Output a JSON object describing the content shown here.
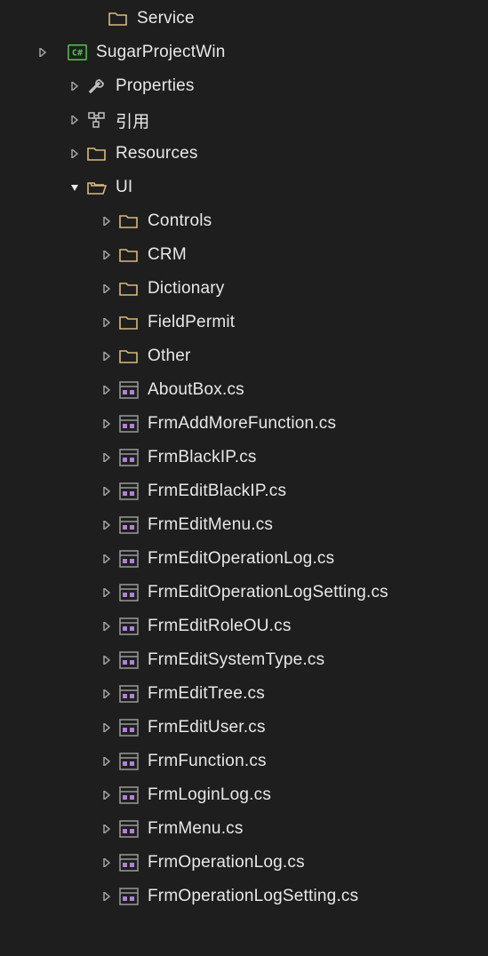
{
  "colors": {
    "background": "#1e1e1e",
    "text": "#e8e8e8",
    "arrow": "#a0a0a0",
    "folderOutline": "#d7ba7d",
    "folderOpen": "#d7ba7d",
    "csharpGreen": "#4ec94e",
    "csharpText": "#4ec94e",
    "wrench": "#c0c0c0",
    "refIcon": "#c0c0c0",
    "formPurple": "#b180d7",
    "formBorder": "#888888"
  },
  "rows": [
    {
      "level": "lvl0b",
      "arrow": "none",
      "icon": "folder",
      "label": "Service"
    },
    {
      "level": "lvl0",
      "arrow": "right",
      "icon": "csharp",
      "label": "SugarProjectWin",
      "noIndentArrow": true
    },
    {
      "level": "lvl1",
      "arrow": "right",
      "icon": "wrench",
      "label": "Properties"
    },
    {
      "level": "lvl1",
      "arrow": "right",
      "icon": "reference",
      "label": "引用"
    },
    {
      "level": "lvl1",
      "arrow": "right",
      "icon": "folder",
      "label": "Resources"
    },
    {
      "level": "lvl1",
      "arrow": "down",
      "icon": "folder-open",
      "label": "UI"
    },
    {
      "level": "lvl2",
      "arrow": "right",
      "icon": "folder",
      "label": "Controls"
    },
    {
      "level": "lvl2",
      "arrow": "right",
      "icon": "folder",
      "label": "CRM"
    },
    {
      "level": "lvl2",
      "arrow": "right",
      "icon": "folder",
      "label": "Dictionary"
    },
    {
      "level": "lvl2",
      "arrow": "right",
      "icon": "folder",
      "label": "FieldPermit"
    },
    {
      "level": "lvl2",
      "arrow": "right",
      "icon": "folder",
      "label": "Other"
    },
    {
      "level": "lvl2",
      "arrow": "right",
      "icon": "form",
      "label": "AboutBox.cs"
    },
    {
      "level": "lvl2",
      "arrow": "right",
      "icon": "form",
      "label": "FrmAddMoreFunction.cs"
    },
    {
      "level": "lvl2",
      "arrow": "right",
      "icon": "form",
      "label": "FrmBlackIP.cs"
    },
    {
      "level": "lvl2",
      "arrow": "right",
      "icon": "form",
      "label": "FrmEditBlackIP.cs"
    },
    {
      "level": "lvl2",
      "arrow": "right",
      "icon": "form",
      "label": "FrmEditMenu.cs"
    },
    {
      "level": "lvl2",
      "arrow": "right",
      "icon": "form",
      "label": "FrmEditOperationLog.cs"
    },
    {
      "level": "lvl2",
      "arrow": "right",
      "icon": "form",
      "label": "FrmEditOperationLogSetting.cs"
    },
    {
      "level": "lvl2",
      "arrow": "right",
      "icon": "form",
      "label": "FrmEditRoleOU.cs"
    },
    {
      "level": "lvl2",
      "arrow": "right",
      "icon": "form",
      "label": "FrmEditSystemType.cs"
    },
    {
      "level": "lvl2",
      "arrow": "right",
      "icon": "form",
      "label": "FrmEditTree.cs"
    },
    {
      "level": "lvl2",
      "arrow": "right",
      "icon": "form",
      "label": "FrmEditUser.cs"
    },
    {
      "level": "lvl2",
      "arrow": "right",
      "icon": "form",
      "label": "FrmFunction.cs"
    },
    {
      "level": "lvl2",
      "arrow": "right",
      "icon": "form",
      "label": "FrmLoginLog.cs"
    },
    {
      "level": "lvl2",
      "arrow": "right",
      "icon": "form",
      "label": "FrmMenu.cs"
    },
    {
      "level": "lvl2",
      "arrow": "right",
      "icon": "form",
      "label": "FrmOperationLog.cs"
    },
    {
      "level": "lvl2",
      "arrow": "right",
      "icon": "form",
      "label": "FrmOperationLogSetting.cs"
    }
  ]
}
